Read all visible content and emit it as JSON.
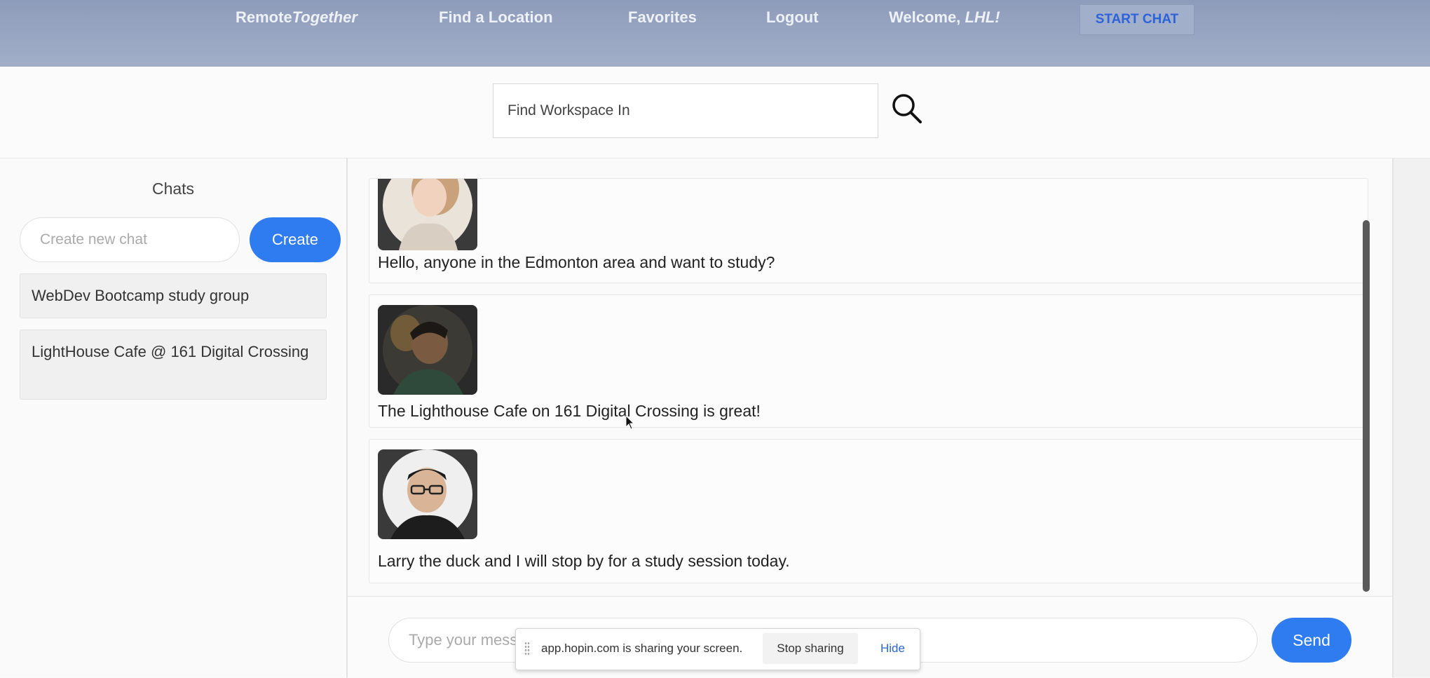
{
  "nav": {
    "brand_plain": "Remote",
    "brand_italic": "Together",
    "find_location": "Find a Location",
    "favorites": "Favorites",
    "logout": "Logout",
    "welcome_prefix": "Welcome,",
    "welcome_name": "LHL!",
    "start_chat": "START CHAT"
  },
  "search": {
    "placeholder": "Find Workspace In"
  },
  "sidebar": {
    "title": "Chats",
    "new_chat_placeholder": "Create new chat",
    "create_label": "Create",
    "rooms": [
      {
        "name": "WebDev Bootcamp study group"
      },
      {
        "name": "LightHouse Cafe @ 161 Digital Crossing"
      }
    ]
  },
  "messages": [
    {
      "text": "Hello, anyone in the Edmonton area and want to study?"
    },
    {
      "text": "The Lighthouse Cafe on 161 Digital Crossing is great!"
    },
    {
      "text": "Larry the duck and I will stop by for a study session today."
    }
  ],
  "compose": {
    "placeholder": "Type your message",
    "send_label": "Send"
  },
  "share_bar": {
    "text": "app.hopin.com is sharing your screen.",
    "stop_label": "Stop sharing",
    "hide_label": "Hide"
  },
  "colors": {
    "nav_bg": "#97a5c2",
    "accent_blue": "#2f7cf0",
    "start_chat_text": "#2d63d8"
  }
}
